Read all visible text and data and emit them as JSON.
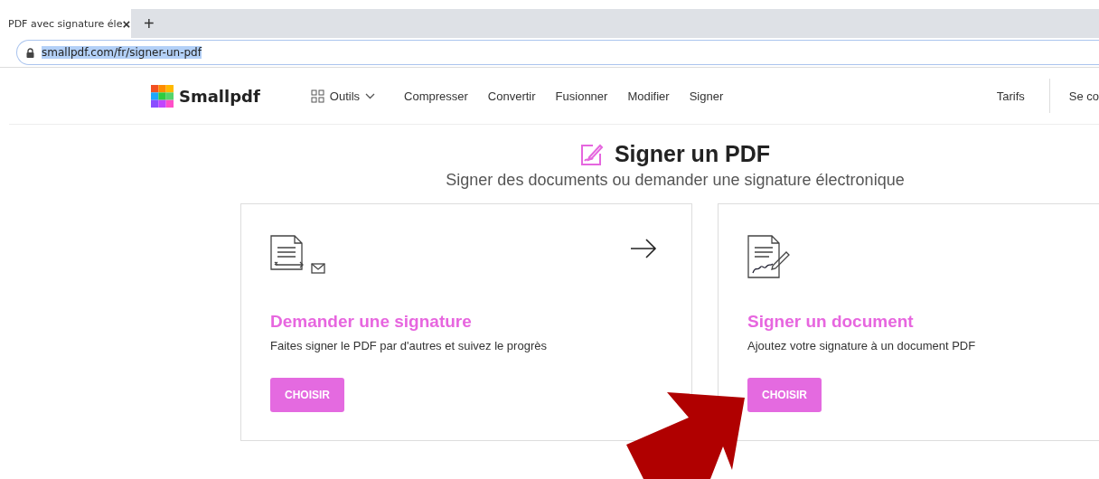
{
  "browser": {
    "tab": {
      "title": "PDF avec signature éle",
      "close": "×"
    },
    "new_tab": "+",
    "url": "smallpdf.com/fr/signer-un-pdf",
    "url_selected": true
  },
  "nav": {
    "logo": "Smallpdf",
    "tools_menu": "Outils",
    "links": [
      "Compresser",
      "Convertir",
      "Fusionner",
      "Modifier",
      "Signer"
    ],
    "right_links": [
      "Tarifs",
      "Se co"
    ]
  },
  "heading": {
    "title": "Signer un PDF",
    "subtitle": "Signer des documents ou demander une signature électronique"
  },
  "cards": [
    {
      "kind": "request",
      "title": "Demander une signature",
      "description": "Faites signer le PDF par d'autres et suivez le progrès",
      "button": "CHOISIR",
      "arrow": true
    },
    {
      "kind": "sign",
      "title": "Signer un document",
      "description": "Ajoutez votre signature à un document PDF",
      "button": "CHOISIR",
      "arrow": false
    }
  ],
  "annotation": {
    "kind": "arrow"
  }
}
